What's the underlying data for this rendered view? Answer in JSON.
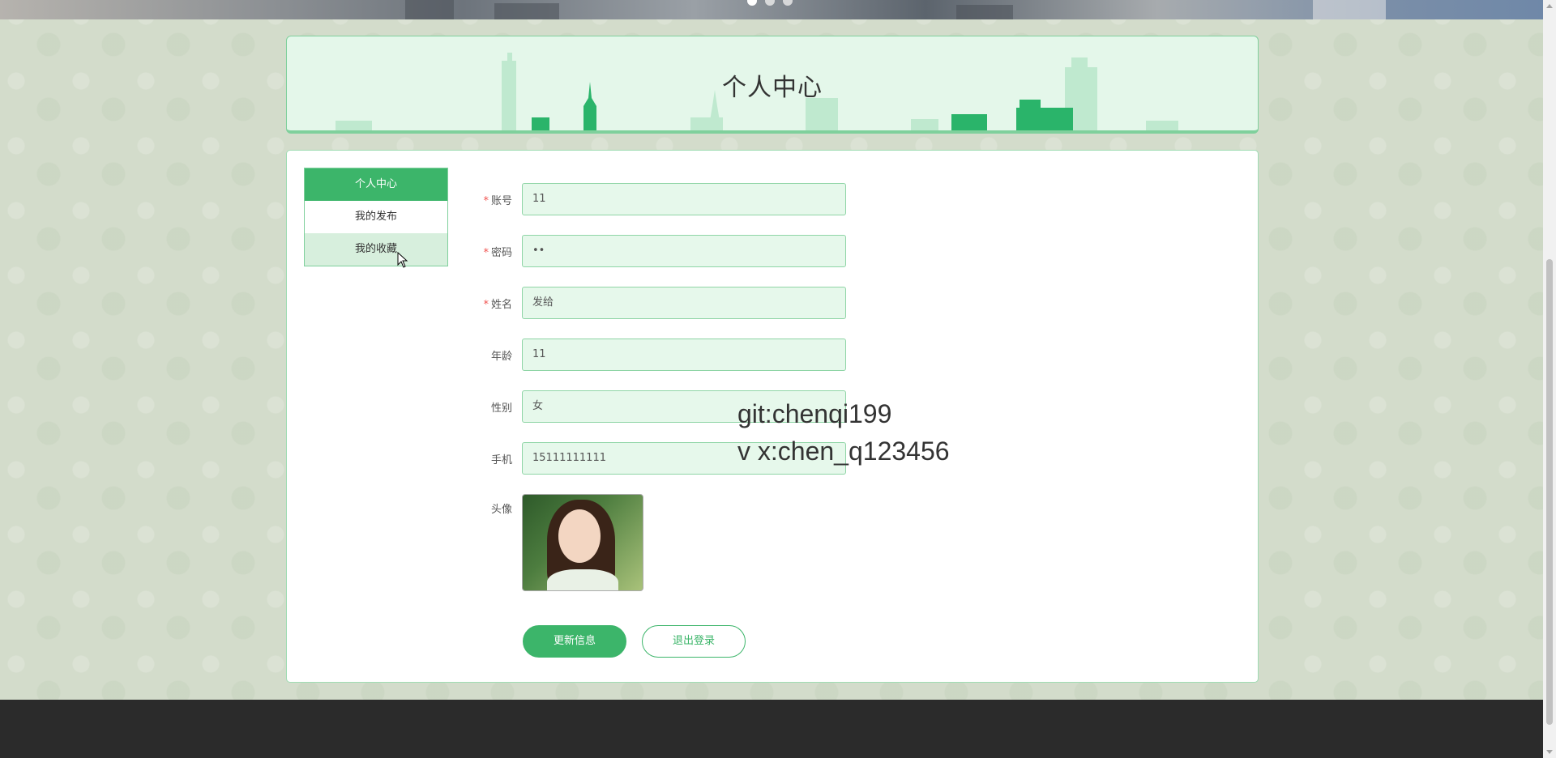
{
  "banner": {
    "slides": 3,
    "active_slide": 1
  },
  "page_title": "个人中心",
  "sidebar": {
    "items": [
      {
        "label": "个人中心",
        "state": "active"
      },
      {
        "label": "我的发布",
        "state": "normal"
      },
      {
        "label": "我的收藏",
        "state": "hover"
      }
    ]
  },
  "form": {
    "fields": [
      {
        "label": "账号",
        "required": true,
        "value": "11"
      },
      {
        "label": "密码",
        "required": true,
        "value": "••"
      },
      {
        "label": "姓名",
        "required": true,
        "value": "发给"
      },
      {
        "label": "年龄",
        "required": false,
        "value": "11"
      },
      {
        "label": "性别",
        "required": false,
        "value": "女"
      },
      {
        "label": "手机",
        "required": false,
        "value": "15111111111"
      }
    ],
    "avatar_label": "头像",
    "required_mark": "*"
  },
  "buttons": {
    "update": "更新信息",
    "logout": "退出登录"
  },
  "watermark": {
    "line1": "git:chenqi199",
    "line2": "v x:chen_q123456"
  },
  "colors": {
    "accent": "#3cb56a",
    "input_bg": "#e6f8eb",
    "footer": "#2b2b2b"
  }
}
